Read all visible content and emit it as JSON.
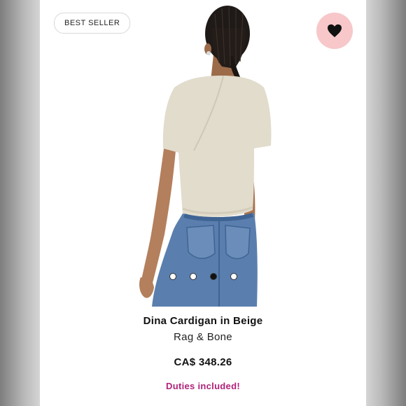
{
  "badge": {
    "label": "BEST SELLER"
  },
  "favorite": {
    "icon": "heart-icon",
    "accent": "#f7c7c9"
  },
  "gallery": {
    "total": 4,
    "active_index": 2
  },
  "product": {
    "name": "Dina Cardigan in Beige",
    "brand": "Rag & Bone",
    "price": "CA$ 348.26",
    "duties_note": "Duties included!"
  },
  "colors": {
    "duties": "#b1227a",
    "sweater": "#e2dccd",
    "denim": "#5a7fae"
  }
}
